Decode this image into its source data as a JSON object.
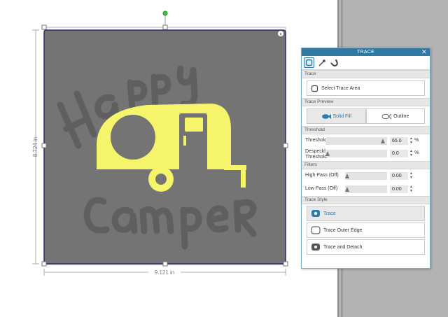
{
  "canvas": {
    "height_label": "8.724 in",
    "width_label": "9.121 in",
    "corner_x": "x"
  },
  "artwork": {
    "top_text": "Happy",
    "bottom_text": "Camper",
    "colors": {
      "background": "#747474",
      "lettering": "#5f5f5f",
      "camper": "#f6f46a"
    }
  },
  "trace_panel": {
    "title": "TRACE",
    "close": "✕",
    "tabs": [
      {
        "name": "trace-tab",
        "icon": "trace-outline-icon",
        "active": true
      },
      {
        "name": "eyedropper-tab",
        "icon": "eyedropper-icon",
        "active": false
      },
      {
        "name": "magnet-tab",
        "icon": "magnet-icon",
        "active": false
      }
    ],
    "sections": {
      "trace": "Trace",
      "trace_preview": "Trace Preview",
      "threshold": "Threshold",
      "filters": "Filters",
      "trace_style": "Trace Style"
    },
    "select_trace_area": "Select Trace Area",
    "preview": {
      "solid_fill": "Solid Fill",
      "outline": "Outline",
      "selected": "solid_fill"
    },
    "sliders": {
      "threshold": {
        "label": "Threshold",
        "value": "65.0",
        "unit": "%",
        "fraction": 0.65
      },
      "despeckle": {
        "label1": "Despeckle",
        "label2": "Threshold",
        "value": "0.0",
        "unit": "%",
        "fraction": 0.0
      },
      "high_pass": {
        "label": "High Pass (Off)",
        "value": "0.00",
        "fraction": 0.0
      },
      "low_pass": {
        "label": "Low Pass (Off)",
        "value": "0.00",
        "fraction": 0.0
      }
    },
    "spin_up": "▲",
    "spin_down": "▼",
    "styles": {
      "trace": "Trace",
      "trace_outer_edge": "Trace Outer Edge",
      "trace_and_detach": "Trace and Detach",
      "selected": "trace"
    }
  }
}
